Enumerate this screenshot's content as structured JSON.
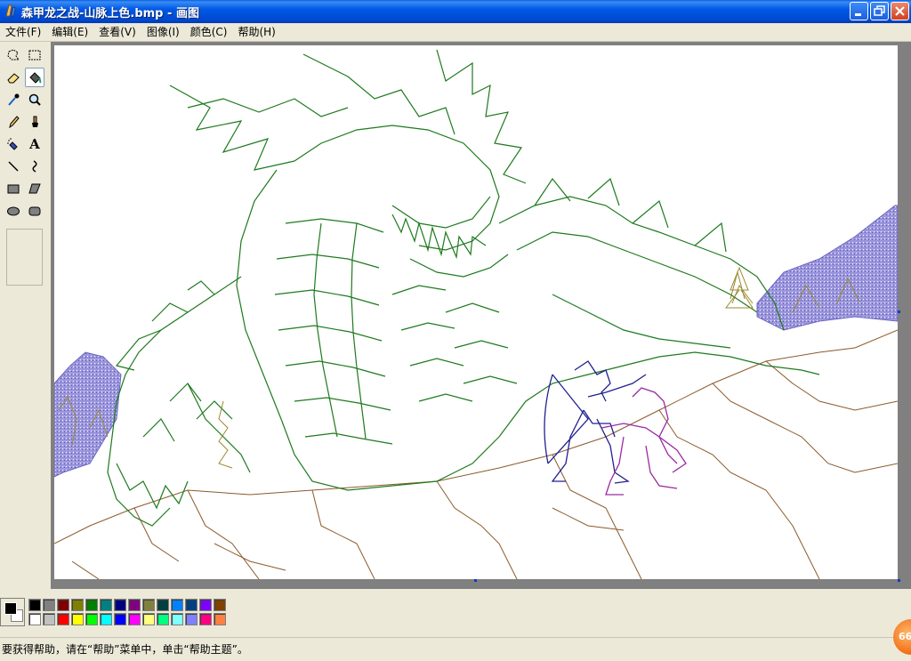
{
  "window": {
    "title": "森甲龙之战-山脉上色.bmp - 画图",
    "minimize_icon": "minimize-icon",
    "maximize_icon": "restore-icon",
    "close_icon": "close-icon"
  },
  "menu": [
    {
      "label": "文件(F)"
    },
    {
      "label": "编辑(E)"
    },
    {
      "label": "查看(V)"
    },
    {
      "label": "图像(I)"
    },
    {
      "label": "颜色(C)"
    },
    {
      "label": "帮助(H)"
    }
  ],
  "tools": [
    {
      "name": "free-form-select-icon"
    },
    {
      "name": "rect-select-icon"
    },
    {
      "name": "eraser-icon"
    },
    {
      "name": "fill-bucket-icon",
      "selected": true
    },
    {
      "name": "pick-color-icon"
    },
    {
      "name": "magnifier-icon"
    },
    {
      "name": "pencil-icon"
    },
    {
      "name": "brush-icon"
    },
    {
      "name": "airbrush-icon"
    },
    {
      "name": "text-icon",
      "glyph": "A"
    },
    {
      "name": "line-icon"
    },
    {
      "name": "curve-icon"
    },
    {
      "name": "rectangle-icon"
    },
    {
      "name": "polygon-icon"
    },
    {
      "name": "ellipse-icon"
    },
    {
      "name": "rounded-rect-icon"
    }
  ],
  "palette": {
    "foreground": "#000000",
    "background": "#ffffff",
    "row1": [
      "#000000",
      "#808080",
      "#800000",
      "#808000",
      "#008000",
      "#008080",
      "#000080",
      "#800080",
      "#808040",
      "#004040",
      "#0080ff",
      "#004080",
      "#8000ff",
      "#804000"
    ],
    "row2": [
      "#ffffff",
      "#c0c0c0",
      "#ff0000",
      "#ffff00",
      "#00ff00",
      "#00ffff",
      "#0000ff",
      "#ff00ff",
      "#ffff80",
      "#00ff80",
      "#80ffff",
      "#8080ff",
      "#ff0080",
      "#ff8040"
    ]
  },
  "status": {
    "help_text": "要获得帮助，请在“帮助”菜单中，单击“帮助主题”。",
    "counter": "66"
  },
  "colors": {
    "lineart_green": "#1e7a1e",
    "lineart_brown": "#8b5a2b",
    "mountain_purple": "#7a74c8",
    "archer_blue": "#202090",
    "creature_magenta": "#9a2aa0"
  }
}
